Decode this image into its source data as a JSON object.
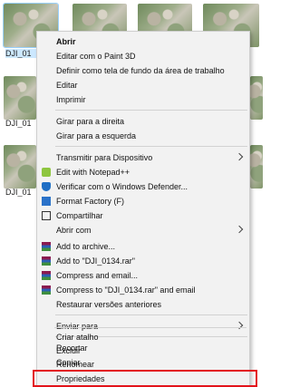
{
  "thumbnails": [
    {
      "caption": "DJI_01",
      "selected": true
    }
  ],
  "captions": [
    "DJI_01",
    "DJI_01",
    "DJI_01"
  ],
  "menu": {
    "open": "Abrir",
    "edit_paint3d": "Editar com o Paint 3D",
    "set_wallpaper": "Definir como tela de fundo da área de trabalho",
    "edit": "Editar",
    "print": "Imprimir",
    "rotate_right": "Girar para a direita",
    "rotate_left": "Girar para a esquerda",
    "cast": "Transmitir para Dispositivo",
    "notepad": "Edit with Notepad++",
    "defender": "Verificar com o Windows Defender...",
    "format_factory": "Format Factory (F)",
    "share": "Compartilhar",
    "open_with": "Abrir com",
    "add_archive": "Add to archive...",
    "add_rar": "Add to \"DJI_0134.rar\"",
    "compress_email": "Compress and email...",
    "compress_rar_email": "Compress to \"DJI_0134.rar\" and email",
    "restore": "Restaurar versões anteriores",
    "send_to": "Enviar para",
    "cut": "Recortar",
    "copy": "Copiar",
    "shortcut": "Criar atalho",
    "delete": "Excluir",
    "rename": "Renomear",
    "properties": "Propriedades"
  },
  "colors": {
    "highlight": "#e3131b",
    "menu_bg": "#f2f2f2"
  }
}
